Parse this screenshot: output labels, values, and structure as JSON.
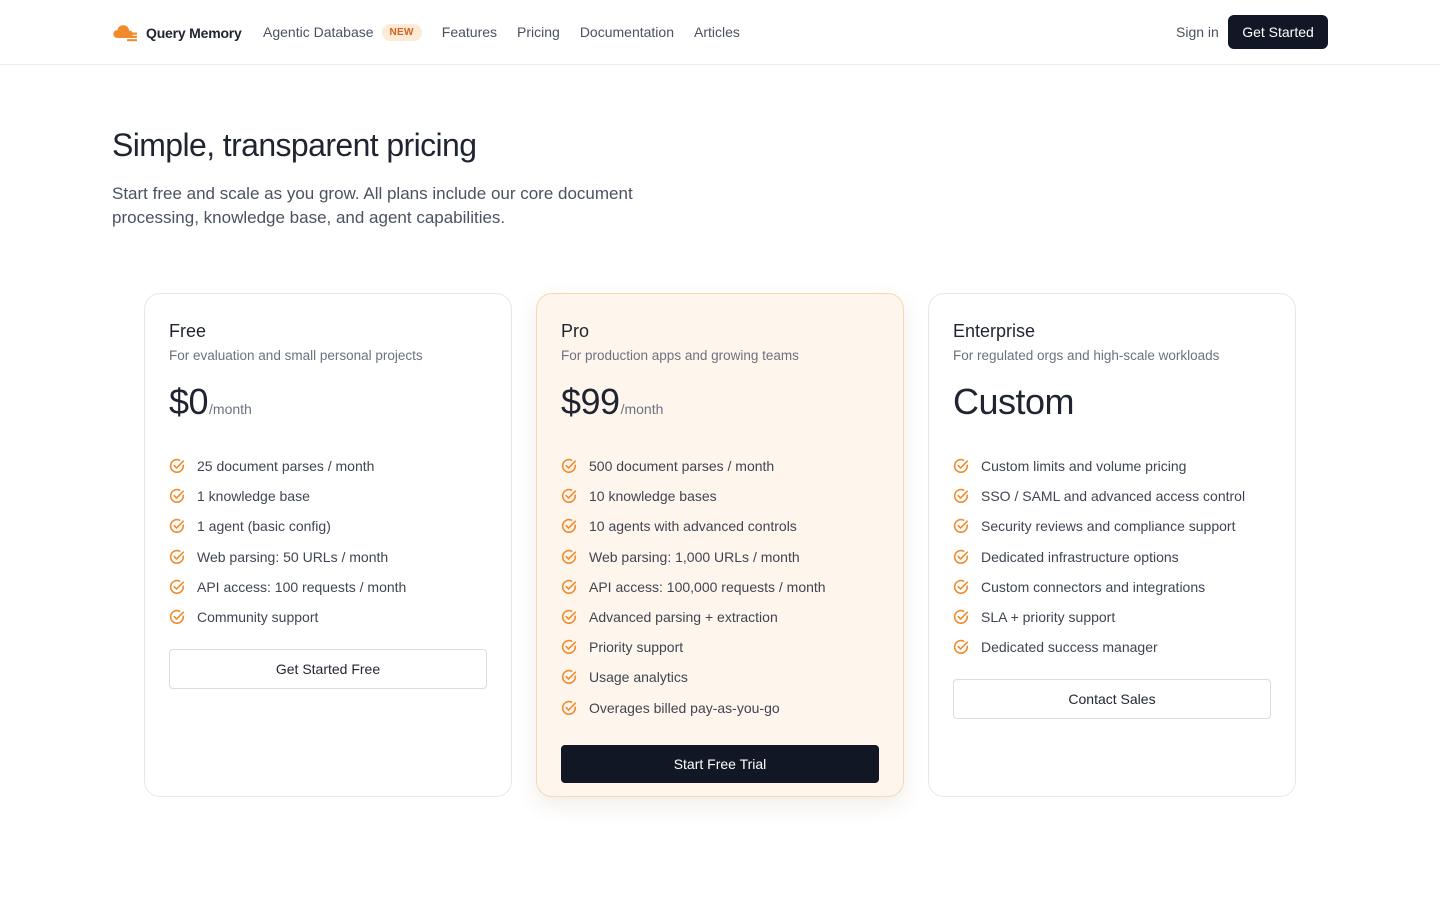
{
  "header": {
    "brand": "Query Memory",
    "nav": [
      {
        "label": "Agentic Database",
        "badge": "NEW"
      },
      {
        "label": "Features"
      },
      {
        "label": "Pricing"
      },
      {
        "label": "Documentation"
      },
      {
        "label": "Articles"
      }
    ],
    "sign_in": "Sign in",
    "get_started": "Get Started"
  },
  "hero": {
    "title": "Simple, transparent pricing",
    "subtitle": "Start free and scale as you grow. All plans include our core document processing, knowledge base, and agent capabilities."
  },
  "plans": [
    {
      "name": "Free",
      "description": "For evaluation and small personal projects",
      "price": "$0",
      "period": "/month",
      "features": [
        "25 document parses / month",
        "1 knowledge base",
        "1 agent (basic config)",
        "Web parsing: 50 URLs / month",
        "API access: 100 requests / month",
        "Community support"
      ],
      "cta": "Get Started Free"
    },
    {
      "name": "Pro",
      "description": "For production apps and growing teams",
      "price": "$99",
      "period": "/month",
      "features": [
        "500 document parses / month",
        "10 knowledge bases",
        "10 agents with advanced controls",
        "Web parsing: 1,000 URLs / month",
        "API access: 100,000 requests / month",
        "Advanced parsing + extraction",
        "Priority support",
        "Usage analytics",
        "Overages billed pay-as-you-go"
      ],
      "cta": "Start Free Trial"
    },
    {
      "name": "Enterprise",
      "description": "For regulated orgs and high-scale workloads",
      "price": "Custom",
      "period": "",
      "features": [
        "Custom limits and volume pricing",
        "SSO / SAML and advanced access control",
        "Security reviews and compliance support",
        "Dedicated infrastructure options",
        "Custom connectors and integrations",
        "SLA + priority support",
        "Dedicated success manager"
      ],
      "cta": "Contact Sales"
    }
  ],
  "colors": {
    "accent": "#f08a2c",
    "dark": "#121726",
    "highlight_card": "#fef6ed"
  },
  "icons": {
    "logo": "cloud-database-icon",
    "feature": "check-circle-icon"
  }
}
